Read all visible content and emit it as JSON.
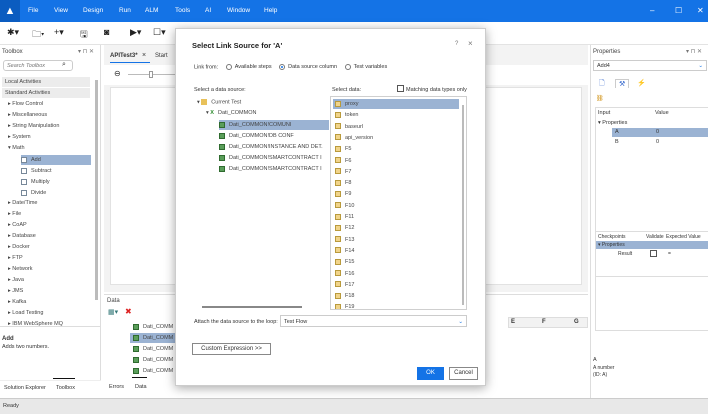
{
  "menubar": {
    "items": [
      "File",
      "View",
      "Design",
      "Run",
      "ALM",
      "Tools",
      "AI",
      "Window",
      "Help"
    ]
  },
  "toolbox": {
    "title": "Toolbox",
    "search_placeholder": "Search Toolbox",
    "groups": [
      "Local Activities",
      "Standard Activities"
    ],
    "items": [
      "Flow Control",
      "Miscellaneous",
      "String Manipulation",
      "System",
      "Math"
    ],
    "math_items": [
      "Add",
      "Subtract",
      "Multiply",
      "Divide"
    ],
    "items_after": [
      "Date/Time",
      "File",
      "CoAP",
      "Database",
      "Docker",
      "FTP",
      "Network",
      "Java",
      "JMS",
      "Kafka",
      "Load Testing",
      "IBM WebSphere MQ"
    ],
    "desc_title": "Add",
    "desc_text": "Adds two numbers."
  },
  "document": {
    "tabs": [
      "APITest3*",
      "Start"
    ]
  },
  "data_panel": {
    "title": "Data",
    "rows": [
      "Dati_COMM",
      "Dati_COMM",
      "Dati_COMM",
      "Dati_COMM",
      "Dati_COMM"
    ],
    "columns": [
      "E",
      "F",
      "G"
    ]
  },
  "bottom_tabs_left": [
    "Solution Explorer",
    "Toolbox"
  ],
  "bottom_tabs_mid": [
    "Errors",
    "Data"
  ],
  "properties": {
    "title": "Properties",
    "selected": "Add4",
    "col_input": "Input",
    "col_value": "Value",
    "group": "Properties",
    "rows": [
      {
        "name": "A",
        "value": "0"
      },
      {
        "name": "B",
        "value": "0"
      }
    ],
    "checkpoints": {
      "col1": "Checkpoints",
      "col2": "Validate",
      "col3": "Expected Value",
      "group": "Properties",
      "row": "Result",
      "op": "="
    },
    "desc_title": "A",
    "desc_text": "A number",
    "desc_type": "(ID: A)"
  },
  "status": "Ready",
  "dialog": {
    "title": "Select Link Source for 'A'",
    "help": "?",
    "close": "×",
    "link_from_label": "Link from:",
    "options": [
      "Available steps",
      "Data source column",
      "Test variables"
    ],
    "selected_option": 1,
    "source_label": "Select a data source:",
    "data_label": "Select data:",
    "matching_label": "Matching data types only",
    "tree_root": "Current Test",
    "tree_group": "Dati_COMMON",
    "tree_items": [
      "Dati_COMMON!COMUNI",
      "Dati_COMMON!DB CONF",
      "Dati_COMMON!INSTANCE AND DET.",
      "Dati_COMMON!SMARTCONTRACT I",
      "Dati_COMMON!SMARTCONTRACT I"
    ],
    "data_items": [
      "proxy",
      "token",
      "baseurl",
      "api_version",
      "F5",
      "F6",
      "F7",
      "F8",
      "F9",
      "F10",
      "F11",
      "F12",
      "F13",
      "F14",
      "F15",
      "F16",
      "F17",
      "F18",
      "F19"
    ],
    "attach_label": "Attach the data source to the loop:",
    "attach_value": "Test Flow",
    "custom_btn": "Custom Expression >>",
    "ok": "OK",
    "cancel": "Cancel"
  }
}
